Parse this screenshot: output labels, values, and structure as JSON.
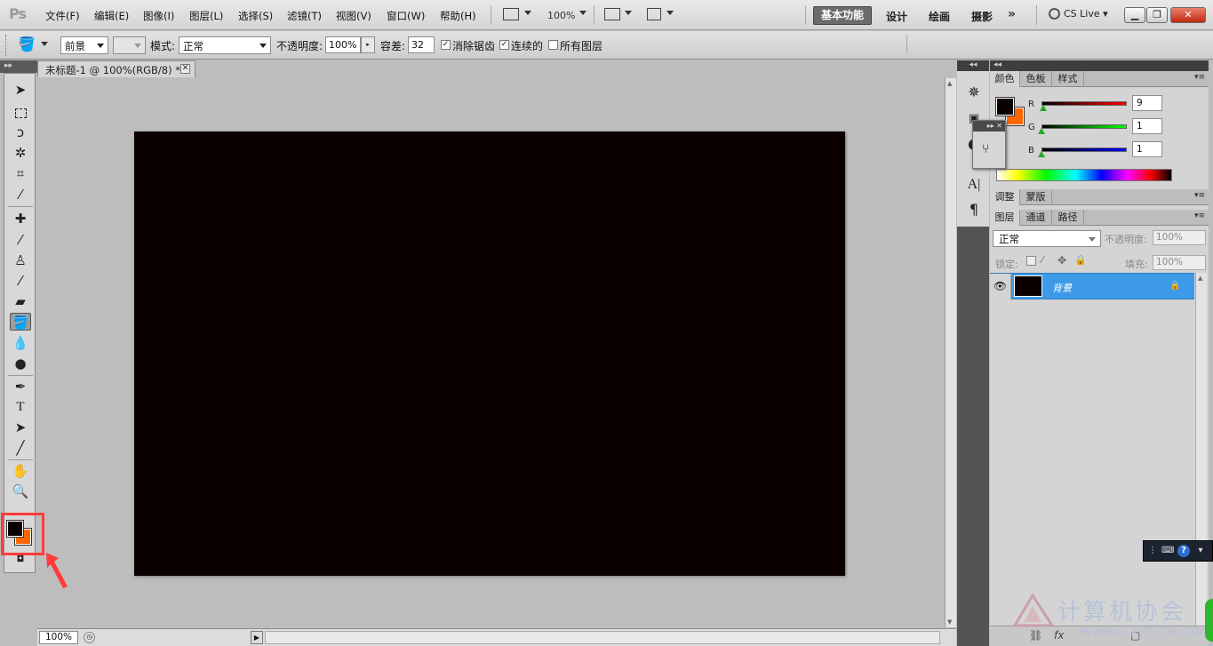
{
  "app": {
    "logo_text": "Ps"
  },
  "menubar": {
    "items": [
      "文件(F)",
      "编辑(E)",
      "图像(I)",
      "图层(L)",
      "选择(S)",
      "滤镜(T)",
      "视图(V)",
      "窗口(W)",
      "帮助(H)"
    ],
    "zoom": "100%",
    "workspaces": {
      "active": "基本功能",
      "others": [
        "设计",
        "绘画",
        "摄影"
      ],
      "more": "»"
    },
    "cs_live": "CS Live ▾"
  },
  "options": {
    "fill_source": "前景",
    "mode_label": "模式:",
    "mode_value": "正常",
    "opacity_label": "不透明度:",
    "opacity_value": "100%",
    "tolerance_label": "容差:",
    "tolerance_value": "32",
    "antialias_label": "消除锯齿",
    "contiguous_label": "连续的",
    "all_layers_label": "所有图层",
    "antialias_checked": true,
    "contiguous_checked": true,
    "all_layers_checked": false
  },
  "document": {
    "tab_title": "未标题-1 @ 100%(RGB/8) *",
    "canvas_color": "#0b0000",
    "status_zoom": "100%"
  },
  "tools": {
    "selected": "paint-bucket-tool",
    "foreground_color": "#0b0000",
    "background_color": "#ff6600"
  },
  "color_panel": {
    "tabs": [
      "颜色",
      "色板",
      "样式"
    ],
    "r_label": "R",
    "g_label": "G",
    "b_label": "B",
    "r_value": "9",
    "g_value": "1",
    "b_value": "1"
  },
  "adjust_panel": {
    "tabs": [
      "调整",
      "蒙版"
    ]
  },
  "layers_panel": {
    "tabs": [
      "图层",
      "通道",
      "路径"
    ],
    "blend_mode": "正常",
    "opacity_label": "不透明度:",
    "opacity_value": "100%",
    "lock_label": "锁定:",
    "fill_label": "填充:",
    "fill_value": "100%",
    "layer_name": "背景"
  },
  "watermark": {
    "text": "计算机协会",
    "url": "www.cxjmca.com"
  },
  "accent_colors": {
    "selection_blue": "#3d9ae8",
    "highlight_red": "#ff3b3b"
  }
}
